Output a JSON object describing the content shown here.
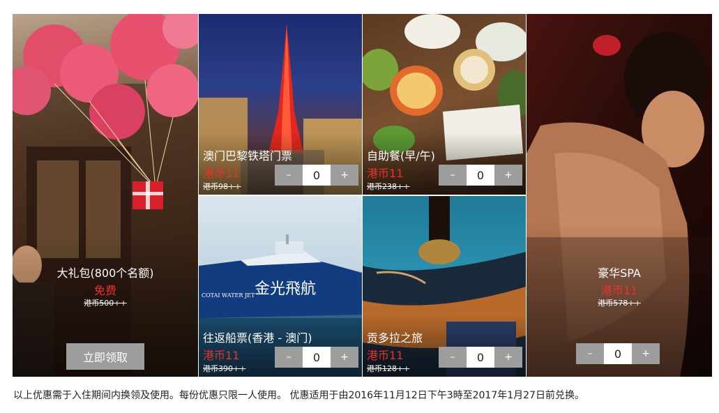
{
  "tiles": {
    "gift": {
      "name": "大礼包(800个名额)",
      "price": "免费",
      "original": "港币500++",
      "claim_label": "立即领取"
    },
    "eiffel": {
      "name": "澳门巴黎铁塔门票",
      "price": "港币11",
      "original": "港币98++",
      "minus": "–",
      "qty": "0",
      "plus": "+"
    },
    "buffet": {
      "name": "自助餐(早/午)",
      "price": "港币11",
      "original": "港币238++",
      "minus": "–",
      "qty": "0",
      "plus": "+"
    },
    "spa": {
      "name": "豪华SPA",
      "price": "港币11",
      "original": "港币578++",
      "minus": "–",
      "qty": "0",
      "plus": "+"
    },
    "ferry": {
      "name": "往返船票(香港 - 澳门)",
      "price": "港币11",
      "original": "港币390++",
      "minus": "–",
      "qty": "0",
      "plus": "+",
      "boat_text": "金光飛航",
      "boat_brand": "COTAI WATER JET"
    },
    "gondola": {
      "name": "贡多拉之旅",
      "price": "港币11",
      "original": "港币128++",
      "minus": "–",
      "qty": "0",
      "plus": "+"
    }
  },
  "footer": {
    "note": "以上优惠需于入住期间内换领及使用。每份优惠只限一人使用。 优惠适用于由2016年11月12日下午3時至2017年1月27日前兑换。"
  },
  "colors": {
    "price": "#e8332a",
    "button": "#9d9d9d"
  }
}
